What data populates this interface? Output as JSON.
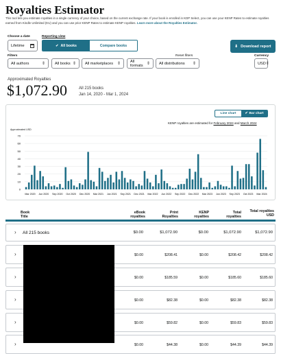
{
  "page": {
    "title": "Royalties Estimator",
    "description": "This tool lets you estimate royalties in a single currency of your choice, based on the current exchange rate. If your book is enrolled in KDP Select, you can use your KENP Rates to estimate royalties earned from Kindle Unlimited (KU) and you can use prior KENP Rates to estimate KENP royalties.",
    "learn_more": "Learn more about the Royalties Estimator."
  },
  "controls": {
    "choose_date_label": "Choose a date",
    "date_value": "Lifetime",
    "reporting_view_label": "Reporting view",
    "all_books_label": "All books",
    "compare_books_label": "Compare books",
    "download_label": "Download report",
    "filters_label": "Filters",
    "reset_filters_label": "Reset filters",
    "currency_label": "Currency",
    "filters": [
      "All authors",
      "All books",
      "All marketplaces",
      "All formats",
      "All distributions"
    ],
    "currency_value": "USD"
  },
  "summary": {
    "label": "Approximated Royalties",
    "total": "$1,072.90",
    "books_count": "All 215 books",
    "date_range": "Jan 14, 2020 - Mar 1, 2024"
  },
  "chart_controls": {
    "line_chart": "Line chart",
    "bar_chart": "Bar chart",
    "kenp_note_prefix": "KENP royalties are estimated for",
    "kenp_feb": "February 2024",
    "kenp_and": "and",
    "kenp_mar": "March 2024"
  },
  "chart_data": {
    "type": "bar",
    "ylabel": "Approximated USD",
    "ylim": [
      0,
      70
    ],
    "yticks": [
      0,
      10,
      20,
      30,
      40,
      50,
      60,
      70
    ],
    "grid": true,
    "xtick_labels": [
      "Mar 2020",
      "Jun 2020",
      "Sep 2020",
      "Oct 2020",
      "Dec 2020",
      "Mar 2021",
      "Jun 2021",
      "Sep 2021",
      "Dec 2021",
      "Mar 2022",
      "Jun 2022",
      "Sep 2022",
      "Dec 2022",
      "Mar 2023",
      "Jun 2023",
      "Sep 2023",
      "Oct 2023",
      "Mar 2024"
    ],
    "values": [
      3,
      9,
      19,
      31,
      12,
      24,
      17,
      4,
      8,
      4,
      5,
      3,
      7,
      2,
      29,
      11,
      13,
      5,
      3,
      8,
      6,
      13,
      49,
      12,
      10,
      4,
      28,
      23,
      11,
      15,
      19,
      9,
      23,
      13,
      24,
      15,
      9,
      13,
      11,
      4,
      7,
      5,
      24,
      14,
      9,
      4,
      19,
      8,
      26,
      11,
      8,
      4,
      2,
      2,
      6,
      7,
      7,
      14,
      27,
      13,
      23,
      46,
      15,
      3,
      3,
      9,
      2,
      4,
      11,
      6,
      4,
      4,
      2,
      31,
      4,
      24,
      14,
      15,
      33,
      33,
      17,
      5,
      48,
      66,
      25,
      3
    ]
  },
  "table": {
    "headers": {
      "book": "Book",
      "title": "Title",
      "ebook": "eBook royalties",
      "print": "Print Royalties",
      "kenp": "KENP royalties",
      "total": "Total royalties",
      "total_usd": "Total royalties USD"
    },
    "summary_row": {
      "label": "All 215 books",
      "ebook": "$0.00",
      "print": "$1,072.90",
      "kenp": "$0.00",
      "total": "$1,072.90",
      "total_usd": "$1,072.90"
    },
    "rows": [
      {
        "ebook": "$0.00",
        "print": "$208.41",
        "kenp": "$0.00",
        "total": "$208.42",
        "total_usd": "$208.42"
      },
      {
        "ebook": "$0.00",
        "print": "$185.59",
        "kenp": "$0.00",
        "total": "$185.60",
        "total_usd": "$185.60"
      },
      {
        "ebook": "$0.00",
        "print": "$82.38",
        "kenp": "$0.00",
        "total": "$82.38",
        "total_usd": "$82.38"
      },
      {
        "ebook": "$0.00",
        "print": "$59.82",
        "kenp": "$0.00",
        "total": "$59.83",
        "total_usd": "$59.83"
      },
      {
        "ebook": "$0.00",
        "print": "$44.38",
        "kenp": "$0.00",
        "total": "$44.39",
        "total_usd": "$44.39"
      }
    ]
  },
  "colors": {
    "accent": "#1f6f87",
    "redaction": "#000000"
  }
}
